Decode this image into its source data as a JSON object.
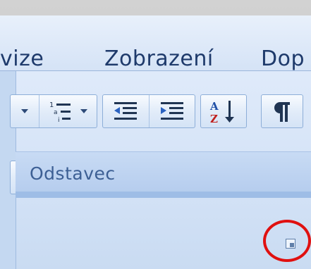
{
  "tabs": [
    {
      "label": "vize"
    },
    {
      "label": "Zobrazení"
    },
    {
      "label": "Dop"
    }
  ],
  "ribbon": {
    "group_label": "Odstavec"
  },
  "icons": {
    "multilevel_list": "multilevel-list-icon",
    "decrease_indent": "decrease-indent-icon",
    "increase_indent": "increase-indent-icon",
    "sort": "sort-az-icon",
    "pilcrow": "pilcrow-icon",
    "align_right": "align-right-icon",
    "justify": "justify-icon",
    "line_spacing": "line-spacing-icon",
    "shading": "shading-bucket-icon",
    "borders": "borders-icon",
    "dialog_launcher": "dialog-launcher-icon"
  },
  "colors": {
    "annotation_circle": "#e01010",
    "shading_swatch": "#ffffff",
    "accent": "#1e3a6b"
  }
}
